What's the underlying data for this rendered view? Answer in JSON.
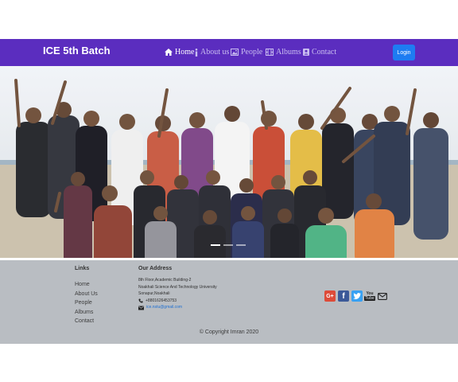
{
  "brand": "ICE 5th Batch",
  "nav": {
    "items": [
      {
        "label": "Home",
        "icon": "home-icon"
      },
      {
        "label": "About us",
        "icon": "info-icon"
      },
      {
        "label": "People",
        "icon": "image-icon"
      },
      {
        "label": "Albums",
        "icon": "film-icon"
      },
      {
        "label": "Contact",
        "icon": "contact-icon"
      }
    ],
    "login_label": "Login"
  },
  "colors": {
    "navbar": "#5b2dbf",
    "login_button": "#1e7cf2",
    "footer": "#b9bdc2",
    "link": "#1f6fd1"
  },
  "hero": {
    "image": "group-photo",
    "indicator_count": 3,
    "active_indicator": 1
  },
  "footer": {
    "links_heading": "Links",
    "links": [
      "Home",
      "About Us",
      "People",
      "Albums",
      "Contact"
    ],
    "address_heading": "Our Address",
    "address_lines": [
      "8th Floor,Academic Building-2",
      "Noakhali Science And Technology University",
      "Sonapur,Noakhali"
    ],
    "phone": "+8801626453753",
    "email": "ice.nstu@gmail.com",
    "social": [
      "google-plus-icon",
      "facebook-icon",
      "twitter-icon",
      "youtube-icon",
      "mail-icon"
    ],
    "copyright": "© Copyright Imran 2020"
  }
}
